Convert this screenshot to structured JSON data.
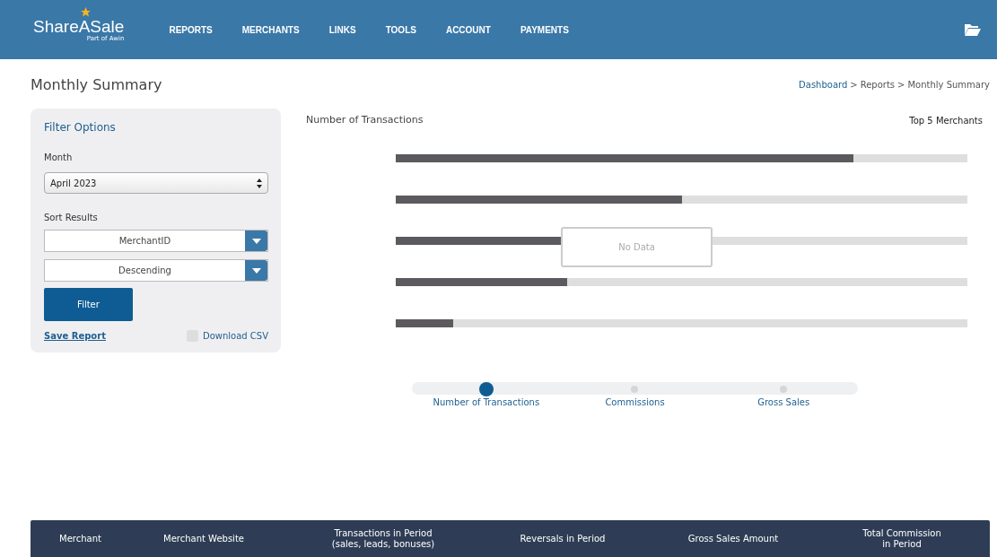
{
  "header": {
    "logo": "ShareASale",
    "logo_sub": "Part of Awin",
    "nav": [
      "REPORTS",
      "MERCHANTS",
      "LINKS",
      "TOOLS",
      "ACCOUNT",
      "PAYMENTS"
    ]
  },
  "page_title": "Monthly Summary",
  "breadcrumb": [
    {
      "label": "Dashboard",
      "link": true
    },
    {
      "label": ">",
      "link": false
    },
    {
      "label": "Reports",
      "link": false
    },
    {
      "label": ">",
      "link": false
    },
    {
      "label": "Monthly Summary",
      "link": false
    }
  ],
  "filter": {
    "title": "Filter Options",
    "month_label": "Month",
    "month_value": "April 2023",
    "sort_label": "Sort Results",
    "sort_by": "MerchantID",
    "sort_order": "Descending",
    "filter_button": "Filter",
    "save_report": "Save Report",
    "download_csv": {
      "label": "Download CSV",
      "checked": false
    }
  },
  "chart": {
    "title": "Number of Transactions",
    "legend": "Top 5 Merchants",
    "no_data": "No Data",
    "bars": [
      {
        "level": 0.8
      },
      {
        "level": 0.5
      },
      {
        "level": 0.29
      },
      {
        "level": 0.3
      },
      {
        "level": 0.1
      }
    ]
  },
  "metric_switch": [
    {
      "label": "Number of Transactions",
      "selected": true
    },
    {
      "label": "Commissions",
      "selected": false
    },
    {
      "label": "Gross Sales",
      "selected": false
    }
  ],
  "table": {
    "columns": [
      "Merchant",
      "Merchant Website",
      "Transactions in Period\n(sales, leads, bonuses)",
      "Reversals in Period",
      "Gross Sales Amount",
      "Total Commission\nin Period"
    ]
  }
}
